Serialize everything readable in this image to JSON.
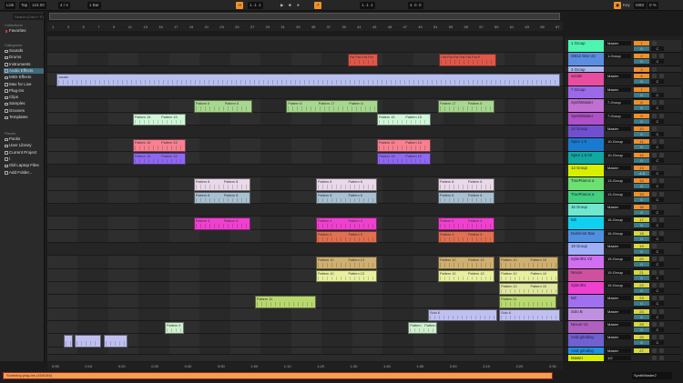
{
  "transport": {
    "link": "Link",
    "tap": "Tap",
    "tempo": "124.00",
    "meter": "4 / 4",
    "quantize": "1 Bar",
    "position": "1. 1. 1",
    "loop_start": "1. 1. 1",
    "loop_length": "4. 0. 0",
    "key": "Key",
    "midi": "MIDI",
    "cpu": "0 %"
  },
  "browser": {
    "search_placeholder": "Search (Cmd + F)",
    "collections_title": "Collections",
    "favorites": "Favorites",
    "categories_title": "Categories",
    "categories": [
      "Sounds",
      "Drums",
      "Instruments",
      "Audio Effects",
      "MIDI Effects",
      "Max for Live",
      "Plug-ins",
      "Clips",
      "Samples",
      "Grooves",
      "Templates"
    ],
    "selected_category": "Audio Effects",
    "places_title": "Places",
    "places": [
      "Packs",
      "User Library",
      "Current Project",
      "\\",
      "Old Laptop Files",
      "Add Folder..."
    ]
  },
  "ruler": {
    "bars": [
      "1",
      "3",
      "5",
      "7",
      "9",
      "11",
      "13",
      "15",
      "17",
      "19",
      "21",
      "23",
      "25",
      "27",
      "29",
      "31",
      "33",
      "35",
      "37",
      "39",
      "41",
      "43",
      "45",
      "47",
      "49",
      "51",
      "53",
      "55",
      "57",
      "59",
      "61",
      "63",
      "65",
      "67"
    ],
    "times": [
      "0:00",
      "0:10",
      "0:20",
      "0:30",
      "0:40",
      "0:50",
      "1:00",
      "1:10",
      "1:20",
      "1:30",
      "1:40",
      "1:50",
      "2:00",
      "2:10",
      "2:20",
      "2:30"
    ]
  },
  "tracks": [
    {
      "name": "1 Group",
      "color": "#4ef5b0",
      "routing": "Master",
      "num": "1",
      "vol": "0",
      "group": true
    },
    {
      "name": "OB12 Sine 22",
      "color": "#5b8ee0",
      "routing": "1-Group",
      "num": "2",
      "vol": "0"
    },
    {
      "name": "3 Group",
      "color": "#a8b8f0",
      "routing": "",
      "num": "3",
      "vol": "",
      "group": true
    },
    {
      "name": "vocals",
      "color": "#e84da0",
      "routing": "Master",
      "num": "4",
      "vol": "0"
    },
    {
      "name": "7 Group",
      "color": "#9a6ae8",
      "routing": "Master",
      "num": "7",
      "vol": "0",
      "group": true
    },
    {
      "name": "SynthMaster",
      "color": "#c070d0",
      "routing": "7-Group",
      "num": "8",
      "vol": "0"
    },
    {
      "name": "SynthMaster",
      "color": "#b050c8",
      "routing": "7-Group",
      "num": "9",
      "vol": "0"
    },
    {
      "name": "10 Group",
      "color": "#7050d0",
      "routing": "Master",
      "num": "10",
      "vol": "0",
      "group": true
    },
    {
      "name": "Spire 1.5",
      "color": "#1a7ad0",
      "routing": "10-Group",
      "num": "11",
      "vol": "0"
    },
    {
      "name": "Spire 1.5 02",
      "color": "#10a8a0",
      "routing": "10-Group",
      "num": "12",
      "vol": "0"
    },
    {
      "name": "13 Group",
      "color": "#d8f000",
      "routing": "Master",
      "num": "13",
      "vol": "-4.3",
      "group": true
    },
    {
      "name": "TruePianos a",
      "color": "#6ce070",
      "routing": "13-Group",
      "num": "14",
      "vol": "0"
    },
    {
      "name": "TruePianos a",
      "color": "#40d080",
      "routing": "13-Group",
      "num": "15",
      "vol": "0"
    },
    {
      "name": "16 Group",
      "color": "#70e8d0",
      "routing": "Master",
      "num": "16",
      "vol": "0",
      "group": true
    },
    {
      "name": "kdt",
      "color": "#10d0f0",
      "routing": "16-Group",
      "num": "17",
      "vol": "0"
    },
    {
      "name": "Dubmont Bas",
      "color": "#5090e0",
      "routing": "16-Group",
      "num": "18",
      "vol": "0"
    },
    {
      "name": "19 Group",
      "color": "#a0b0f8",
      "routing": "Master",
      "num": "19",
      "vol": "0",
      "group": true
    },
    {
      "name": "Sylenth1 V2",
      "color": "#d070f0",
      "routing": "19-Group",
      "num": "20",
      "vol": "0"
    },
    {
      "name": "Nexus",
      "color": "#d050a0",
      "routing": "19-Group",
      "num": "21",
      "vol": "0"
    },
    {
      "name": "Sylenth1",
      "color": "#f040d0",
      "routing": "19-Group",
      "num": "22",
      "vol": "0"
    },
    {
      "name": "kdt",
      "color": "#a070f0",
      "routing": "Master",
      "num": "23",
      "vol": "0"
    },
    {
      "name": "Solo B",
      "color": "#c090e0",
      "routing": "Master",
      "num": "24",
      "vol": "0"
    },
    {
      "name": "Nexus V2",
      "color": "#b060c0",
      "routing": "Master",
      "num": "25",
      "vol": "0"
    },
    {
      "name": "Avid grinding",
      "color": "#7060d0",
      "routing": "Master",
      "num": "26",
      "vol": "0"
    },
    {
      "name": "Avid grinding",
      "color": "#2090e0",
      "routing": "Master",
      "num": "27",
      "vol": "0"
    },
    {
      "name": "Master",
      "color": "#d8f000",
      "routing": "1/2",
      "num": "",
      "vol": "0"
    }
  ],
  "clips": [
    {
      "track": 1,
      "start": 39.75,
      "len": 4,
      "color": "#e0584a",
      "labels": [
        "Pat Pat Pat Pat"
      ]
    },
    {
      "track": 1,
      "start": 51.75,
      "len": 7.5,
      "color": "#e0584a",
      "labels": [
        "Pat Pat Pat Pat Pat Pat P"
      ]
    },
    {
      "track": 3,
      "start": 1.6,
      "len": 66,
      "color": "#b8c0f0",
      "labels": [
        "vocals"
      ]
    },
    {
      "track": 5,
      "start": 19.6,
      "len": 7.6,
      "color": "#a8d890",
      "labels": [
        "Pattern 6",
        "Pattern 6"
      ]
    },
    {
      "track": 5,
      "start": 31.7,
      "len": 12,
      "color": "#a8d890",
      "labels": [
        "Pattern 6",
        "Pattern 17",
        "Pattern 6"
      ]
    },
    {
      "track": 5,
      "start": 51.6,
      "len": 7.4,
      "color": "#a8d890",
      "labels": [
        "Pattern 17",
        "Pattern 6"
      ]
    },
    {
      "track": 6,
      "start": 11.6,
      "len": 7,
      "color": "#d0f8d8",
      "labels": [
        "Pattern 15",
        "Pattern 15"
      ]
    },
    {
      "track": 6,
      "start": 43.6,
      "len": 7,
      "color": "#d0f8d8",
      "labels": [
        "Pattern 15",
        "Pattern 15"
      ]
    },
    {
      "track": 8,
      "start": 11.6,
      "len": 7,
      "color": "#f88090",
      "labels": [
        "Pattern 15",
        "Pattern 15"
      ]
    },
    {
      "track": 8,
      "start": 43.6,
      "len": 7,
      "color": "#f88090",
      "labels": [
        "Pattern 15",
        "Pattern 15"
      ]
    },
    {
      "track": 9,
      "start": 11.6,
      "len": 7,
      "color": "#9068f0",
      "labels": [
        "Pattern 15",
        "Pattern 15"
      ]
    },
    {
      "track": 9,
      "start": 43.6,
      "len": 7,
      "color": "#9068f0",
      "labels": [
        "Pattern 15",
        "Pattern 15"
      ]
    },
    {
      "track": 11,
      "start": 19.6,
      "len": 7.4,
      "color": "#e8d8e8",
      "labels": [
        "Pattern 8",
        "Pattern 8"
      ]
    },
    {
      "track": 11,
      "start": 35.6,
      "len": 8,
      "color": "#e8d8e8",
      "labels": [
        "Pattern 8",
        "Pattern 8"
      ]
    },
    {
      "track": 11,
      "start": 51.6,
      "len": 7.4,
      "color": "#e8d8e8",
      "labels": [
        "Pattern 8",
        "Pattern 8"
      ]
    },
    {
      "track": 12,
      "start": 19.6,
      "len": 7.4,
      "color": "#a8c0d0",
      "labels": [
        "Pattern 8",
        "Pattern 8"
      ]
    },
    {
      "track": 12,
      "start": 35.6,
      "len": 8,
      "color": "#a8c0d0",
      "labels": [
        "Pattern 8",
        "Pattern 8"
      ]
    },
    {
      "track": 12,
      "start": 51.6,
      "len": 7.4,
      "color": "#a8c0d0",
      "labels": [
        "Pattern 8",
        "Pattern 8"
      ]
    },
    {
      "track": 14,
      "start": 19.6,
      "len": 7.4,
      "color": "#f040d0",
      "labels": [
        "Pattern 4",
        "Pattern 4"
      ]
    },
    {
      "track": 14,
      "start": 35.6,
      "len": 8,
      "color": "#f040d0",
      "labels": [
        "Pattern 4",
        "Pattern 4"
      ]
    },
    {
      "track": 14,
      "start": 51.6,
      "len": 7.4,
      "color": "#f040d0",
      "labels": [
        "Pattern 4",
        "Pattern 4"
      ]
    },
    {
      "track": 15,
      "start": 35.6,
      "len": 8,
      "color": "#e07050",
      "labels": [
        "Pattern 4",
        "Pattern 5"
      ]
    },
    {
      "track": 15,
      "start": 51.6,
      "len": 7.4,
      "color": "#e07050",
      "labels": [
        "Pattern 4",
        "Pattern 5"
      ]
    },
    {
      "track": 17,
      "start": 35.6,
      "len": 8,
      "color": "#d0b070",
      "labels": [
        "Pattern 10",
        "Pattern 13"
      ]
    },
    {
      "track": 17,
      "start": 51.6,
      "len": 7.4,
      "color": "#d0b070",
      "labels": [
        "Pattern 10",
        "Pattern 13"
      ]
    },
    {
      "track": 17,
      "start": 59.6,
      "len": 7.75,
      "color": "#d0b070",
      "labels": [
        "Pattern 10",
        "Pattern 10"
      ]
    },
    {
      "track": 18,
      "start": 35.6,
      "len": 8,
      "color": "#e8f0a0",
      "labels": [
        "Pattern 10",
        "Pattern 13"
      ]
    },
    {
      "track": 18,
      "start": 51.6,
      "len": 7.4,
      "color": "#e8f0a0",
      "labels": [
        "Pattern 10",
        "Pattern 13"
      ]
    },
    {
      "track": 18,
      "start": 59.6,
      "len": 7.75,
      "color": "#e8f0a0",
      "labels": [
        "Pattern 10",
        "Pattern 10"
      ]
    },
    {
      "track": 19,
      "start": 59.6,
      "len": 7.75,
      "color": "#e0e8a0",
      "labels": [
        "Pattern 10",
        "Pattern 10"
      ]
    },
    {
      "track": 20,
      "start": 27.6,
      "len": 8,
      "color": "#b8d870",
      "labels": [
        "Pattern 11"
      ]
    },
    {
      "track": 20,
      "start": 59.6,
      "len": 7.5,
      "color": "#b8d870",
      "labels": [
        "Pattern 11"
      ]
    },
    {
      "track": 21,
      "start": 50.3,
      "len": 9,
      "color": "#c0c0f0",
      "labels": [
        "Solo 6"
      ]
    },
    {
      "track": 21,
      "start": 59.6,
      "len": 8,
      "color": "#c0c0f0",
      "labels": [
        "Solo 6"
      ]
    },
    {
      "track": 22,
      "start": 15.8,
      "len": 2.5,
      "color": "#d0f0d0",
      "labels": [
        "Pattern 9"
      ]
    },
    {
      "track": 22,
      "start": 47.7,
      "len": 3.8,
      "color": "#d0f0d0",
      "labels": [
        "Pattern",
        "Pattern"
      ]
    },
    {
      "track": 23,
      "start": 2.55,
      "len": 1.2,
      "color": "#c0c0f0",
      "labels": [
        ""
      ]
    },
    {
      "track": 23,
      "start": 4,
      "len": 3.4,
      "color": "#c0c0f0",
      "labels": [
        ""
      ]
    },
    {
      "track": 23,
      "start": 7.8,
      "len": 3.1,
      "color": "#c0c0f0",
      "labels": [
        ""
      ]
    }
  ],
  "status": {
    "message": "Scanning plug-ins (164/164)",
    "device": "SynthMaster2"
  },
  "colors": {
    "accent": "#f0902a",
    "status_bar": "#f0a050"
  }
}
